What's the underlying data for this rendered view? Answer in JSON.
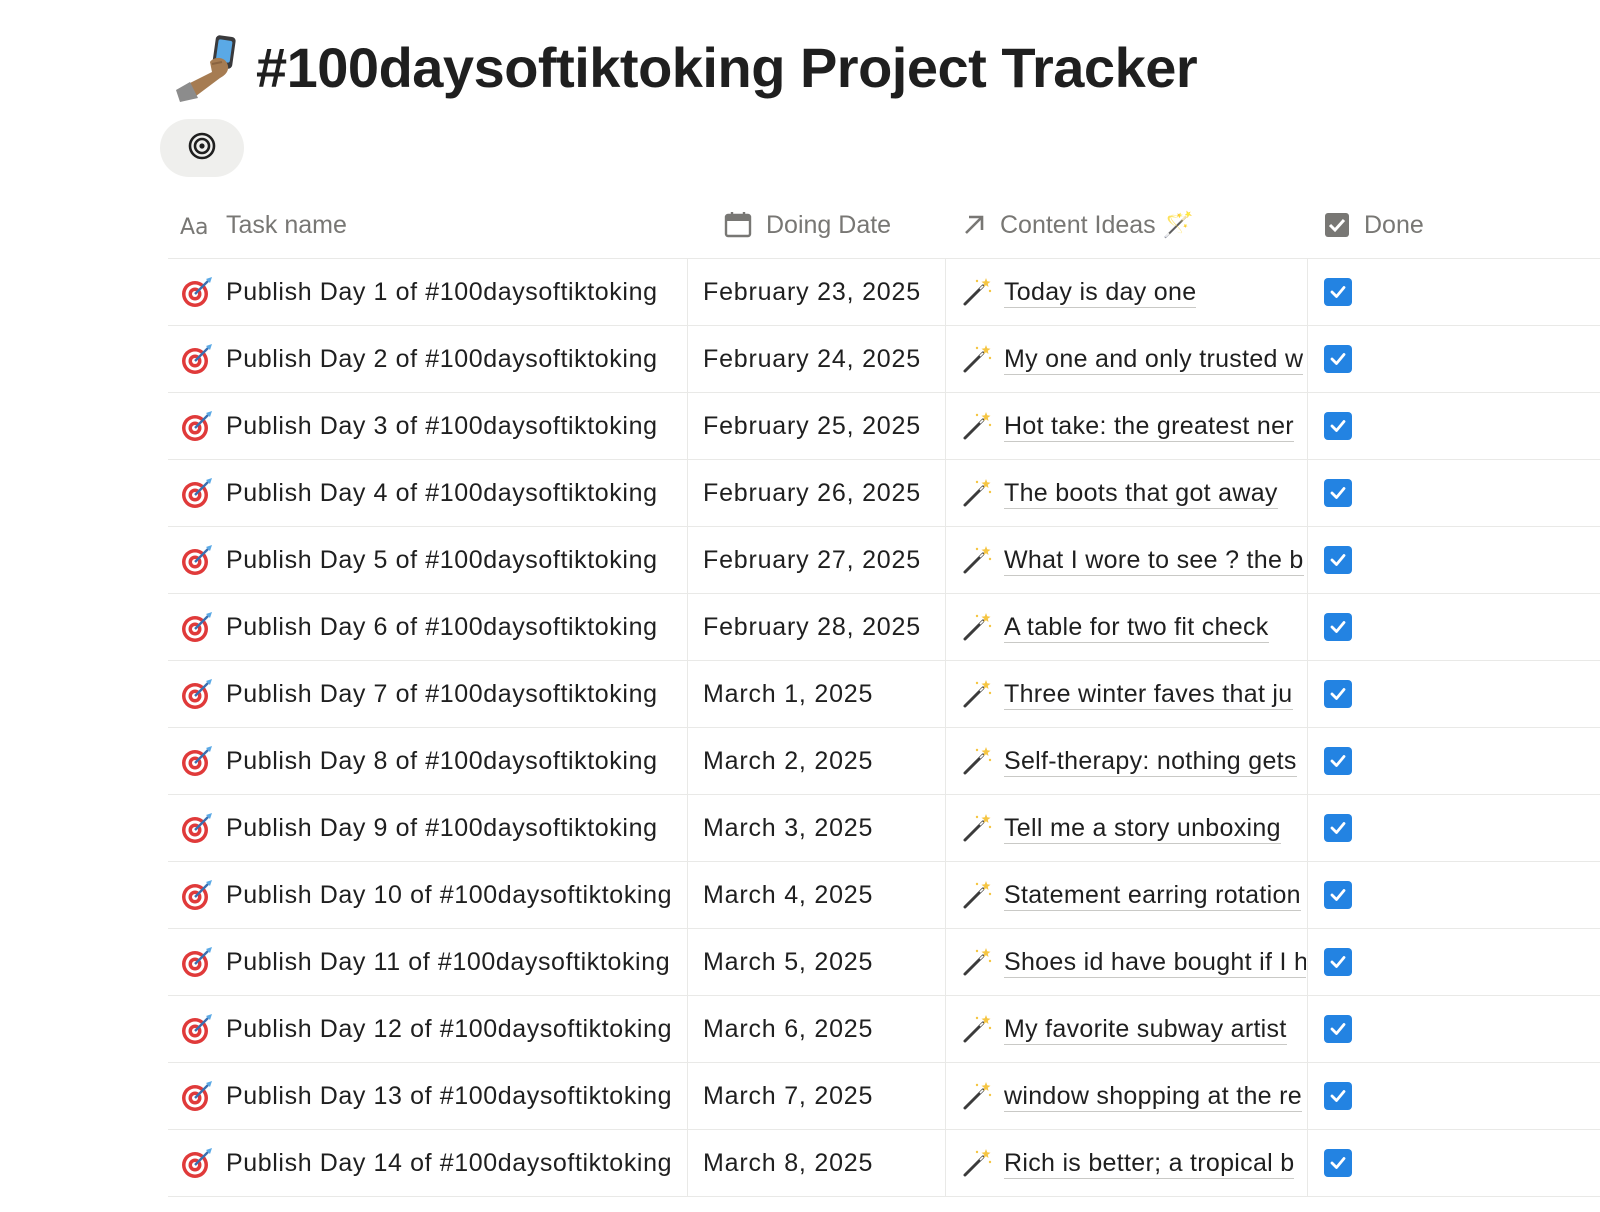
{
  "page": {
    "title": "#100daysoftiktoking Project Tracker",
    "title_icon": "selfie-icon",
    "view_icon": "target-icon"
  },
  "table": {
    "columns": [
      {
        "key": "task",
        "label": "Task name",
        "icon": "text-aa-icon"
      },
      {
        "key": "date",
        "label": "Doing Date",
        "icon": "calendar-icon"
      },
      {
        "key": "ideas",
        "label": "Content Ideas 🪄",
        "icon": "relation-arrow-icon"
      },
      {
        "key": "done",
        "label": "Done",
        "icon": "checkbox-icon"
      }
    ],
    "rows": [
      {
        "task": "Publish Day 1 of #100daysoftiktoking",
        "date": "February 23, 2025",
        "idea": "Today is day one",
        "done": true
      },
      {
        "task": "Publish Day 2 of #100daysoftiktoking",
        "date": "February 24, 2025",
        "idea": "My one and only trusted w",
        "done": true
      },
      {
        "task": "Publish Day 3 of #100daysoftiktoking",
        "date": "February 25, 2025",
        "idea": "Hot take: the greatest ner",
        "done": true
      },
      {
        "task": "Publish Day 4 of #100daysoftiktoking",
        "date": "February 26, 2025",
        "idea": "The boots that got away",
        "done": true
      },
      {
        "task": "Publish Day 5 of #100daysoftiktoking",
        "date": "February 27, 2025",
        "idea": "What I wore to see ? the b",
        "done": true
      },
      {
        "task": "Publish Day 6 of #100daysoftiktoking",
        "date": "February 28, 2025",
        "idea": "A table for two fit check",
        "done": true
      },
      {
        "task": "Publish Day 7 of #100daysoftiktoking",
        "date": "March 1, 2025",
        "idea": "Three winter faves that ju",
        "done": true
      },
      {
        "task": "Publish Day 8 of #100daysoftiktoking",
        "date": "March 2, 2025",
        "idea": "Self-therapy: nothing gets",
        "done": true
      },
      {
        "task": "Publish Day 9 of #100daysoftiktoking",
        "date": "March 3, 2025",
        "idea": "Tell me a story unboxing",
        "done": true
      },
      {
        "task": "Publish Day 10 of #100daysoftiktoking",
        "date": "March 4, 2025",
        "idea": "Statement earring rotation",
        "done": true
      },
      {
        "task": "Publish Day 11 of #100daysoftiktoking",
        "date": "March 5, 2025",
        "idea": "Shoes id have bought if I h",
        "done": true
      },
      {
        "task": "Publish Day 12 of #100daysoftiktoking",
        "date": "March 6, 2025",
        "idea": "My favorite subway artist",
        "done": true
      },
      {
        "task": "Publish Day 13 of #100daysoftiktoking",
        "date": "March 7, 2025",
        "idea": "window shopping at the re",
        "done": true
      },
      {
        "task": "Publish Day 14 of #100daysoftiktoking",
        "date": "March 8, 2025",
        "idea": "Rich is better; a tropical b",
        "done": true
      }
    ]
  },
  "colors": {
    "checkbox": "#2383e2",
    "header_text": "#787774",
    "divider": "#e9e9e7",
    "view_tab_bg": "#efefed"
  }
}
